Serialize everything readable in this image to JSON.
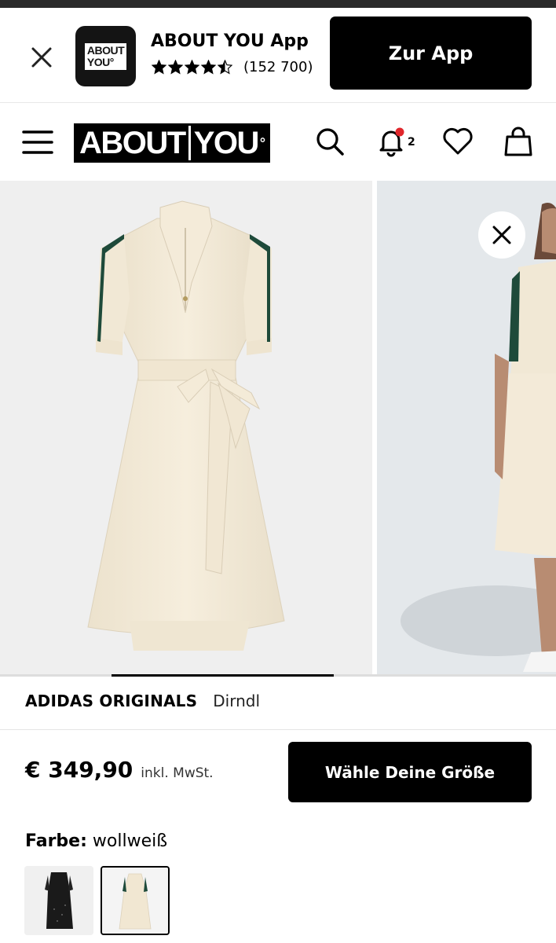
{
  "banner": {
    "app_name": "ABOUT YOU App",
    "icon_text_line1": "ABOUT",
    "icon_text_line2": "YOU°",
    "rating_stars": 4.5,
    "rating_count": "(152 700)",
    "cta_label": "Zur App"
  },
  "header": {
    "logo_left": "ABOUT",
    "logo_right": "YOU",
    "logo_mark": "°",
    "notification_count": "2"
  },
  "gallery": {
    "progress_fraction": 0.4,
    "accent_color": "#1e4a3a",
    "dress_color": "#f3ead8"
  },
  "product": {
    "brand": "ADIDAS ORIGINALS",
    "name": "Dirndl",
    "price": "€ 349,90",
    "tax_note": "inkl. MwSt.",
    "cta_label": "Wähle Deine Größe",
    "color_label": "Farbe:",
    "color_value": "wollweiß"
  }
}
